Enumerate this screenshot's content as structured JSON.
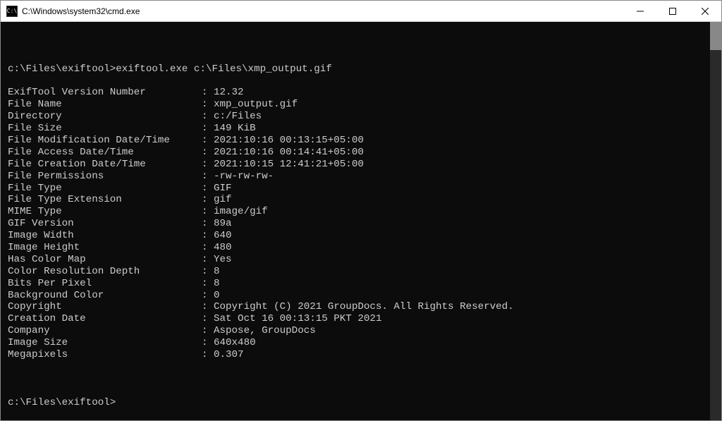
{
  "window": {
    "title": "C:\\Windows\\system32\\cmd.exe"
  },
  "terminal": {
    "prompt_path": "c:\\Files\\exiftool>",
    "command": "exiftool.exe c:\\Files\\xmp_output.gif",
    "rows": [
      {
        "label": "ExifTool Version Number",
        "value": "12.32"
      },
      {
        "label": "File Name",
        "value": "xmp_output.gif"
      },
      {
        "label": "Directory",
        "value": "c:/Files"
      },
      {
        "label": "File Size",
        "value": "149 KiB"
      },
      {
        "label": "File Modification Date/Time",
        "value": "2021:10:16 00:13:15+05:00"
      },
      {
        "label": "File Access Date/Time",
        "value": "2021:10:16 00:14:41+05:00"
      },
      {
        "label": "File Creation Date/Time",
        "value": "2021:10:15 12:41:21+05:00"
      },
      {
        "label": "File Permissions",
        "value": "-rw-rw-rw-"
      },
      {
        "label": "File Type",
        "value": "GIF"
      },
      {
        "label": "File Type Extension",
        "value": "gif"
      },
      {
        "label": "MIME Type",
        "value": "image/gif"
      },
      {
        "label": "GIF Version",
        "value": "89a"
      },
      {
        "label": "Image Width",
        "value": "640"
      },
      {
        "label": "Image Height",
        "value": "480"
      },
      {
        "label": "Has Color Map",
        "value": "Yes"
      },
      {
        "label": "Color Resolution Depth",
        "value": "8"
      },
      {
        "label": "Bits Per Pixel",
        "value": "8"
      },
      {
        "label": "Background Color",
        "value": "0"
      },
      {
        "label": "Copyright",
        "value": "Copyright (C) 2021 GroupDocs. All Rights Reserved."
      },
      {
        "label": "Creation Date",
        "value": "Sat Oct 16 00:13:15 PKT 2021"
      },
      {
        "label": "Company",
        "value": "Aspose, GroupDocs"
      },
      {
        "label": "Image Size",
        "value": "640x480"
      },
      {
        "label": "Megapixels",
        "value": "0.307"
      }
    ],
    "final_prompt": "c:\\Files\\exiftool>"
  }
}
